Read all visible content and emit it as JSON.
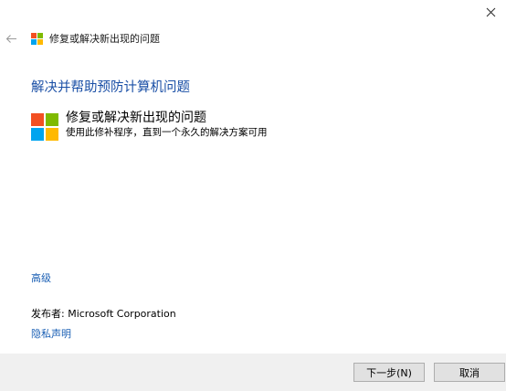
{
  "window": {
    "close_icon": "close-icon",
    "back_icon": "back-arrow-icon",
    "title": "修复或解决新出现的问题",
    "title_icon": "windows-logo-icon"
  },
  "main": {
    "heading": "解决并帮助预防计算机问题",
    "option": {
      "icon": "windows-logo-icon",
      "title": "修复或解决新出现的问题",
      "description": "使用此修补程序，直到一个永久的解决方案可用"
    },
    "advanced_link": "高级",
    "publisher": "发布者:  Microsoft Corporation",
    "privacy_link": "隐私声明"
  },
  "footer": {
    "next_button": "下一步(N)",
    "cancel_button": "取消"
  },
  "colors": {
    "logo_red": "#f25022",
    "logo_green": "#7fba00",
    "logo_blue": "#00a4ef",
    "logo_yellow": "#ffb900",
    "heading_blue": "#1a4fa6",
    "link_blue": "#1a5fb4"
  }
}
